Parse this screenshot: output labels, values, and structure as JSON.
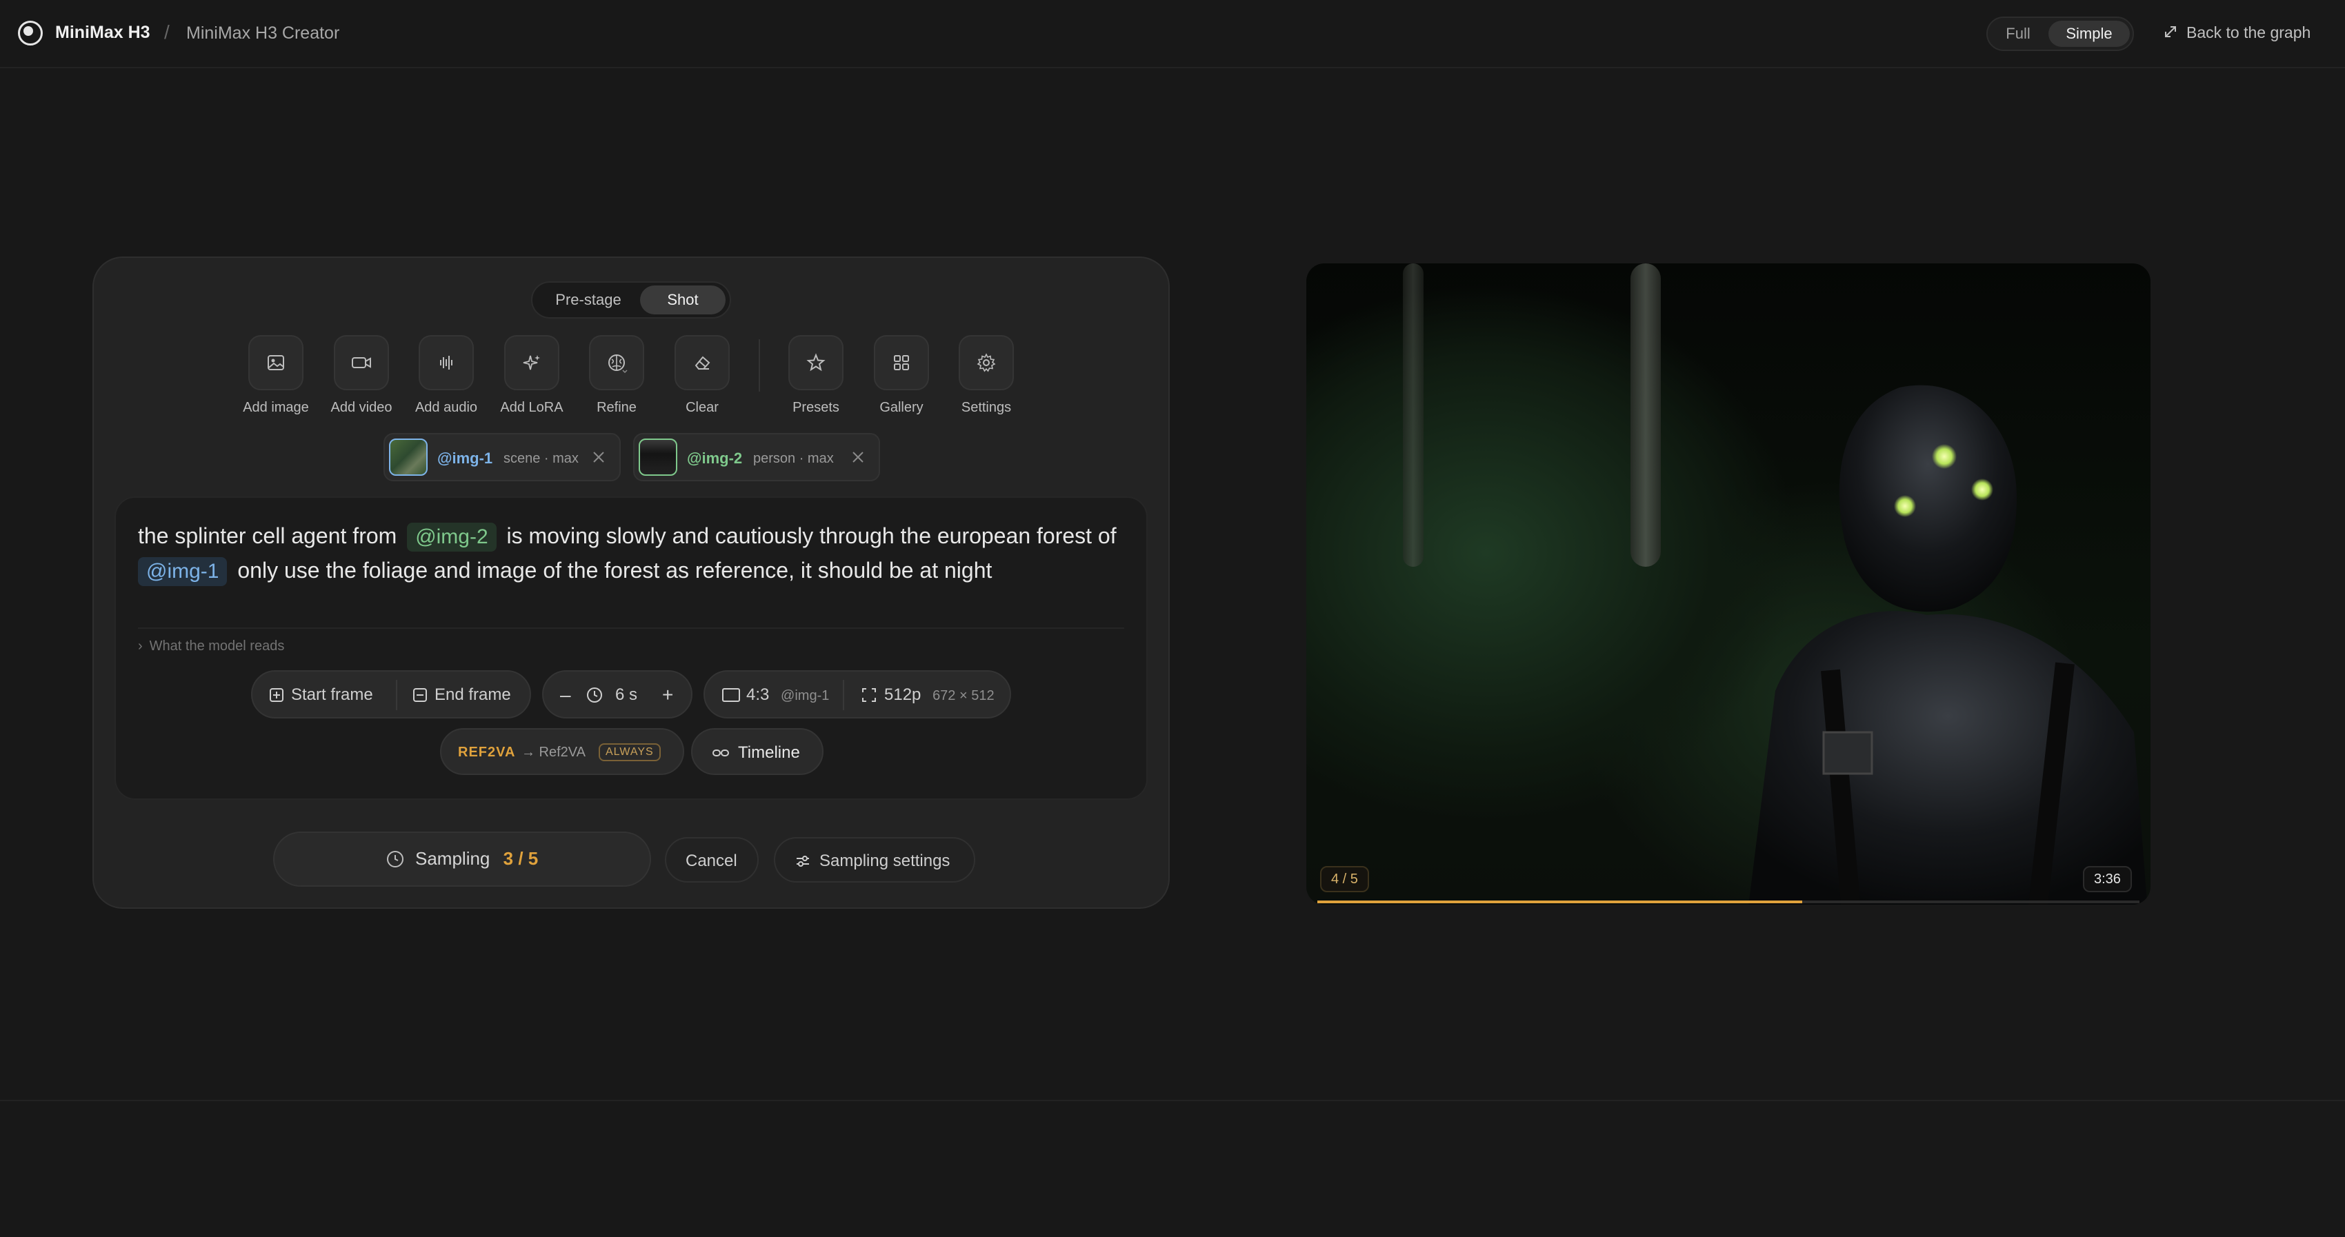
{
  "brand": {
    "name": "MiniMax H3",
    "separator": "/",
    "crumb": "MiniMax H3 Creator"
  },
  "view_mode": {
    "options": [
      "Full",
      "Simple"
    ],
    "selected": "Simple"
  },
  "back_link": {
    "label": "Back to the graph",
    "icon": "expand-arrows-icon"
  },
  "stage_tabs": {
    "items": [
      "Pre-stage",
      "Shot"
    ],
    "selected": "Shot"
  },
  "toolbar": {
    "items": [
      {
        "label": "Add image",
        "icon": "image-icon"
      },
      {
        "label": "Add video",
        "icon": "video-camera-icon"
      },
      {
        "label": "Add audio",
        "icon": "audio-waveform-icon"
      },
      {
        "label": "Add LoRA",
        "icon": "sparkle-icon"
      },
      {
        "label": "Refine",
        "icon": "brain-icon"
      },
      {
        "label": "Clear",
        "icon": "eraser-icon"
      },
      {
        "label": "Presets",
        "icon": "star-icon"
      },
      {
        "label": "Gallery",
        "icon": "grid-icon"
      },
      {
        "label": "Settings",
        "icon": "gear-icon"
      }
    ]
  },
  "references": [
    {
      "id": "@img-1",
      "meta": "scene · max",
      "color": "#7db3e8"
    },
    {
      "id": "@img-2",
      "meta": "person · max",
      "color": "#7fc98c"
    }
  ],
  "prompt": {
    "part1": "the splinter cell agent from",
    "mention1": "@img-2",
    "part2": "is moving slowly and cautiously through the european forest of",
    "mention2": "@img-1",
    "part3": "only use the foliage and image of the forest as reference, it should be at night"
  },
  "model_reads": {
    "label": "What the model reads"
  },
  "controls": {
    "start_frame": "Start frame",
    "end_frame": "End frame",
    "minus": "–",
    "duration": "6 s",
    "plus": "+",
    "aspect": "4:3",
    "aspect_source": "@img-1",
    "resolution": "512p",
    "resolution_size": "672 × 512",
    "mode_tag": "REF2VA",
    "mode_arrow": "→ Ref2VA",
    "mode_badge": "ALWAYS",
    "timeline": "Timeline"
  },
  "actions": {
    "sampling_label": "Sampling",
    "sampling_progress": "3 / 5",
    "cancel": "Cancel",
    "sampling_settings": "Sampling settings"
  },
  "preview": {
    "counter": "4 / 5",
    "duration": "3:36",
    "progress_fraction": 0.59,
    "accent": "#e0a23c"
  }
}
